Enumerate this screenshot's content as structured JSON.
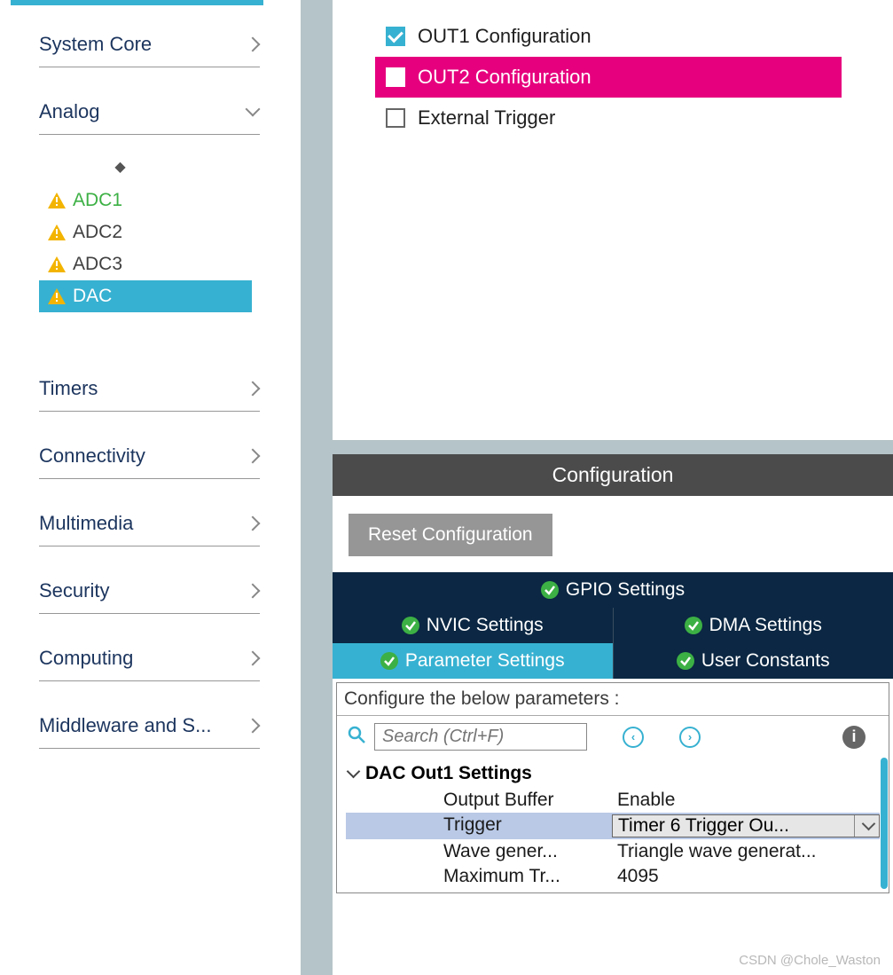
{
  "sidebar": {
    "categories": [
      {
        "label": "System Core",
        "expanded": false
      },
      {
        "label": "Analog",
        "expanded": true
      },
      {
        "label": "Timers",
        "expanded": false
      },
      {
        "label": "Connectivity",
        "expanded": false
      },
      {
        "label": "Multimedia",
        "expanded": false
      },
      {
        "label": "Security",
        "expanded": false
      },
      {
        "label": "Computing",
        "expanded": false
      },
      {
        "label": "Middleware and S...",
        "expanded": false
      }
    ],
    "analog_items": [
      {
        "label": "ADC1",
        "warn": true,
        "green": true,
        "selected": false
      },
      {
        "label": "ADC2",
        "warn": true,
        "green": false,
        "selected": false
      },
      {
        "label": "ADC3",
        "warn": true,
        "green": false,
        "selected": false
      },
      {
        "label": "DAC",
        "warn": true,
        "green": false,
        "selected": true
      }
    ],
    "sort_glyph": "◆"
  },
  "mode": {
    "items": [
      {
        "label": "OUT1 Configuration",
        "checked": true,
        "highlight": false
      },
      {
        "label": "OUT2 Configuration",
        "checked": false,
        "highlight": true
      },
      {
        "label": "External Trigger",
        "checked": false,
        "highlight": false
      }
    ]
  },
  "config": {
    "title": "Configuration",
    "reset_label": "Reset Configuration",
    "tabs": {
      "gpio": "GPIO Settings",
      "nvic": "NVIC Settings",
      "dma": "DMA Settings",
      "param": "Parameter Settings",
      "user": "User Constants"
    },
    "param_instruction": "Configure the below parameters :",
    "search_placeholder": "Search (Ctrl+F)",
    "section_title": "DAC Out1 Settings",
    "params": [
      {
        "label": "Output Buffer",
        "value": "Enable",
        "selected": false,
        "dropdown": false
      },
      {
        "label": "Trigger",
        "value": "Timer 6 Trigger Ou...",
        "selected": true,
        "dropdown": true
      },
      {
        "label": "Wave gener...",
        "value": "Triangle wave generat...",
        "selected": false,
        "dropdown": false
      },
      {
        "label": "Maximum Tr...",
        "value": "4095",
        "selected": false,
        "dropdown": false
      }
    ]
  },
  "watermark": "CSDN @Chole_Waston"
}
